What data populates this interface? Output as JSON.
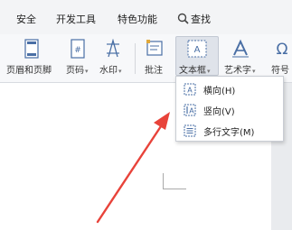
{
  "menubar": {
    "items": [
      "安全",
      "开发工具",
      "特色功能"
    ],
    "search_label": "查找"
  },
  "ribbon": {
    "header_footer": "页眉和页脚",
    "page_number": "页码",
    "watermark": "水印",
    "comment": "批注",
    "textbox": "文本框",
    "wordart": "艺术字",
    "symbol": "符号"
  },
  "dropdown": {
    "items": [
      "横向(H)",
      "竖向(V)",
      "多行文字(M)"
    ]
  },
  "colors": {
    "annotation_arrow": "#e8433a",
    "accent_blue": "#2f6fb6"
  }
}
